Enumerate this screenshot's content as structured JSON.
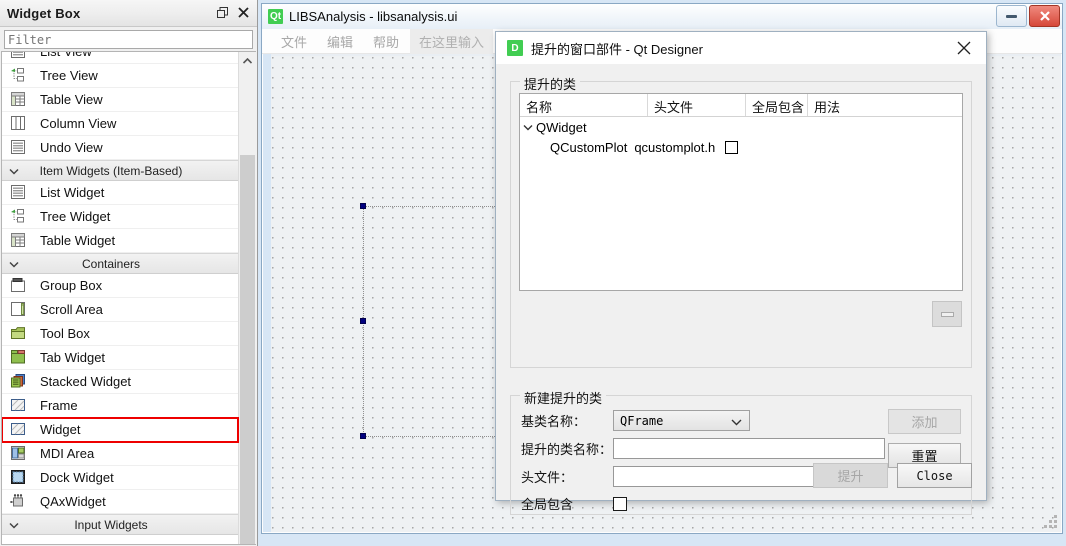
{
  "widget_box": {
    "title": "Widget Box",
    "float_icon": "float-icon",
    "close_icon": "close-icon",
    "filter_placeholder": "Filter",
    "filter_value": "",
    "items": [
      {
        "type": "item",
        "label": "List View",
        "icon": "list-view-icon"
      },
      {
        "type": "item",
        "label": "Tree View",
        "icon": "tree-view-icon"
      },
      {
        "type": "item",
        "label": "Table View",
        "icon": "table-view-icon"
      },
      {
        "type": "item",
        "label": "Column View",
        "icon": "column-view-icon"
      },
      {
        "type": "item",
        "label": "Undo View",
        "icon": "undo-view-icon"
      },
      {
        "type": "group",
        "label": "Item Widgets (Item-Based)"
      },
      {
        "type": "item",
        "label": "List Widget",
        "icon": "list-widget-icon"
      },
      {
        "type": "item",
        "label": "Tree Widget",
        "icon": "tree-widget-icon"
      },
      {
        "type": "item",
        "label": "Table Widget",
        "icon": "table-widget-icon"
      },
      {
        "type": "group",
        "label": "Containers"
      },
      {
        "type": "item",
        "label": "Group Box",
        "icon": "group-box-icon"
      },
      {
        "type": "item",
        "label": "Scroll Area",
        "icon": "scroll-area-icon"
      },
      {
        "type": "item",
        "label": "Tool Box",
        "icon": "tool-box-icon"
      },
      {
        "type": "item",
        "label": "Tab Widget",
        "icon": "tab-widget-icon"
      },
      {
        "type": "item",
        "label": "Stacked Widget",
        "icon": "stacked-widget-icon"
      },
      {
        "type": "item",
        "label": "Frame",
        "icon": "frame-icon"
      },
      {
        "type": "item",
        "label": "Widget",
        "icon": "widget-icon",
        "selected": true
      },
      {
        "type": "item",
        "label": "MDI Area",
        "icon": "mdi-area-icon"
      },
      {
        "type": "item",
        "label": "Dock Widget",
        "icon": "dock-widget-icon"
      },
      {
        "type": "item",
        "label": "QAxWidget",
        "icon": "qax-widget-icon"
      },
      {
        "type": "group",
        "label": "Input Widgets"
      }
    ],
    "selection_color": "#ee0000"
  },
  "main_window": {
    "app_badge": "Qt",
    "title": "LIBSAnalysis - libsanalysis.ui",
    "minimize_label": "minimize-button",
    "close_label": "close-button",
    "menus": [
      "文件",
      "编辑",
      "帮助"
    ],
    "menu_hint": "在这里输入"
  },
  "dialog": {
    "badge": "D",
    "title": "提升的窗口部件 - Qt Designer",
    "close_icon": "close-icon",
    "promoted_group": {
      "title": "提升的类",
      "columns": [
        "名称",
        "头文件",
        "全局包含",
        "用法"
      ],
      "rows": [
        {
          "level": 0,
          "name": "QWidget",
          "header": "",
          "global_include": null,
          "usage": "",
          "expanded": true
        },
        {
          "level": 1,
          "name": "QCustomPlot",
          "header": "qcustomplot.h",
          "global_include": false,
          "usage": ""
        }
      ],
      "remove_button": "—"
    },
    "new_group": {
      "title": "新建提升的类",
      "base_class_label": "基类名称：",
      "base_class_value": "QFrame",
      "promoted_class_label": "提升的类名称：",
      "promoted_class_value": "",
      "header_label": "头文件：",
      "header_value": "",
      "global_include_label": "全局包含",
      "global_include_checked": false,
      "add_button": "添加",
      "reset_button": "重置"
    },
    "buttons": {
      "promote": "提升",
      "close": "Close"
    }
  }
}
